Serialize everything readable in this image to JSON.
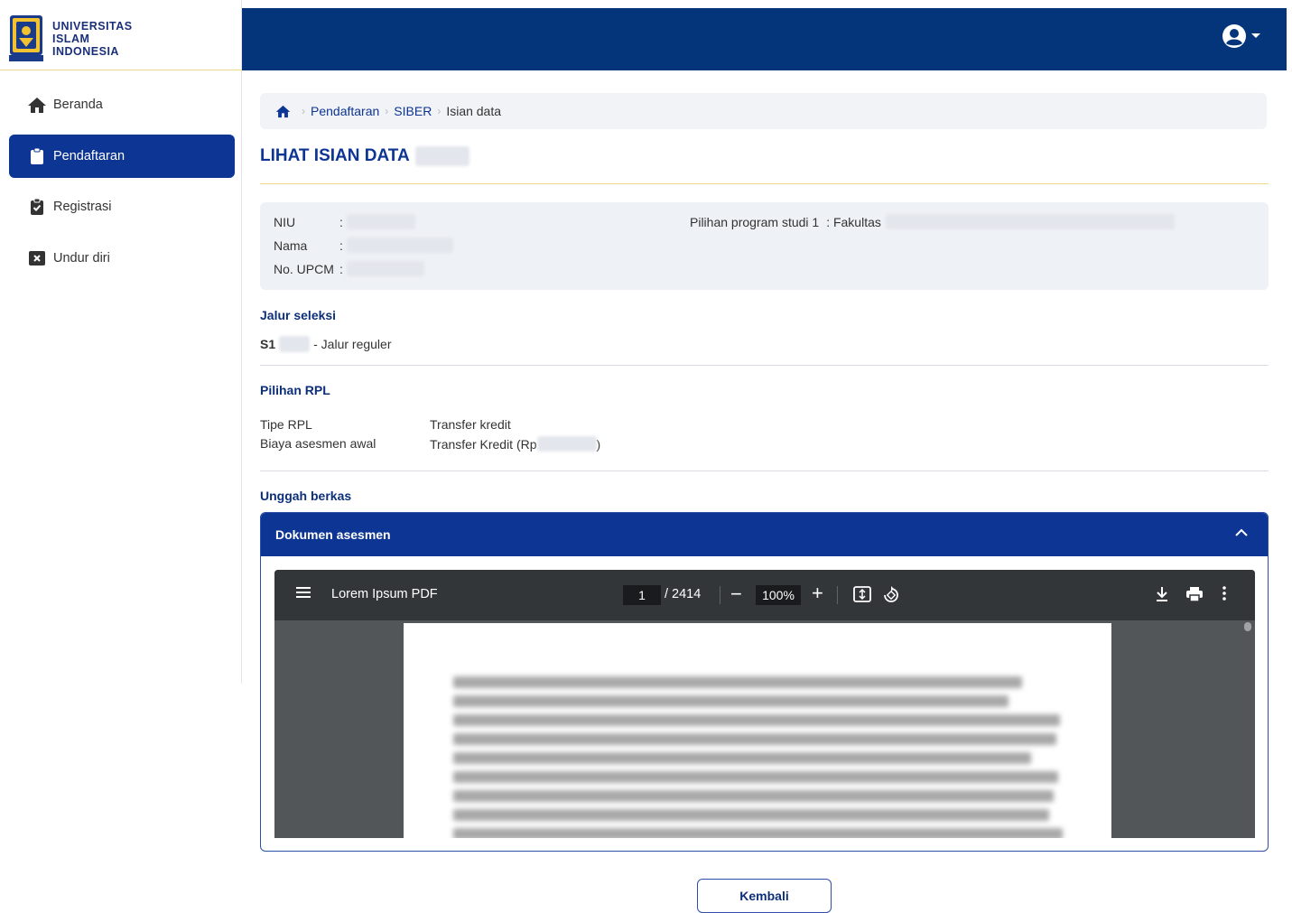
{
  "brand": {
    "line1": "UNIVERSITAS",
    "line2": "ISLAM",
    "line3": "INDONESIA",
    "accent": "#0d3594",
    "topbar": "#04357a"
  },
  "sidebar": {
    "items": [
      {
        "label": "Beranda",
        "icon": "home-icon",
        "active": false
      },
      {
        "label": "Pendaftaran",
        "icon": "clipboard-icon",
        "active": true
      },
      {
        "label": "Registrasi",
        "icon": "clipboard-check-icon",
        "active": false
      },
      {
        "label": "Undur diri",
        "icon": "close-box-icon",
        "active": false
      }
    ]
  },
  "header": {
    "user_icon": "user-circle-icon"
  },
  "breadcrumb": {
    "items": [
      "Pendaftaran",
      "SIBER"
    ],
    "current": "Isian data"
  },
  "page": {
    "title": "LIHAT ISIAN DATA"
  },
  "info": {
    "niu_label": "NIU",
    "nama_label": "Nama",
    "upcm_label": "No. UPCM",
    "colon": ":",
    "prodi_label": "Pilihan program studi 1",
    "prodi_value": ": Fakultas"
  },
  "jalur": {
    "title": "Jalur seleksi",
    "prefix": "S1",
    "suffix": "- Jalur reguler"
  },
  "rpl": {
    "title": "Pilihan RPL",
    "tipe_label": "Tipe RPL",
    "tipe_value": "Transfer kredit",
    "biaya_label": "Biaya asesmen awal",
    "biaya_value_prefix": "Transfer Kredit (Rp",
    "biaya_value_suffix": ")"
  },
  "upload": {
    "title": "Unggah berkas",
    "panel_title": "Dokumen asesmen"
  },
  "pdf": {
    "title": "Lorem Ipsum PDF",
    "page": "1",
    "total": "/ 2414",
    "zoom": "100%"
  },
  "footer": {
    "back_label": "Kembali"
  }
}
